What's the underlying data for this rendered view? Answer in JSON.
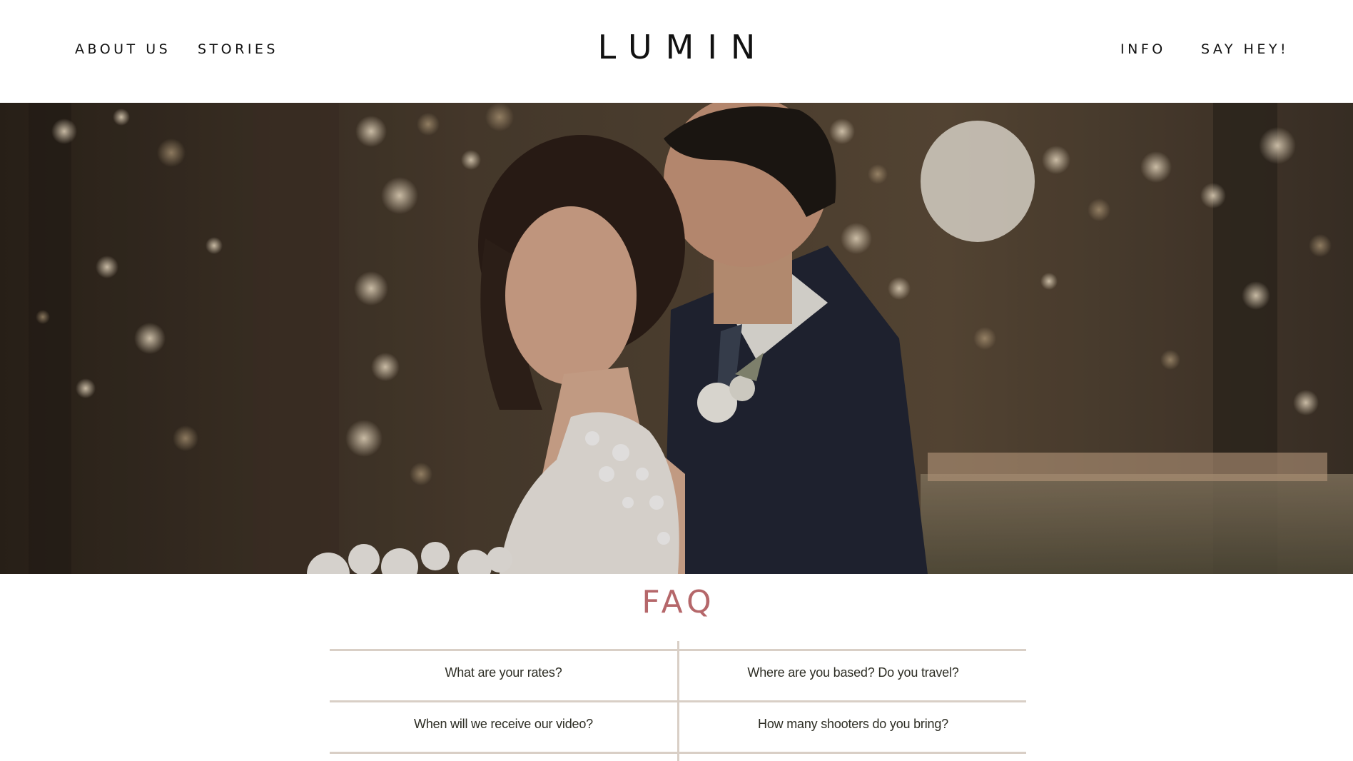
{
  "nav": {
    "about": "ABOUT US",
    "stories": "STORIES",
    "info": "INFO",
    "say_hey": "SAY HEY!"
  },
  "logo": "LUMIN",
  "hero": {
    "icon": "couple-wedding-photo"
  },
  "faq": {
    "title": "FAQ",
    "accent_color": "#b5676a",
    "questions": [
      "What are your rates?",
      "Where are you based? Do you travel?",
      "When will we receive our video?",
      "How many shooters do you bring?"
    ]
  }
}
